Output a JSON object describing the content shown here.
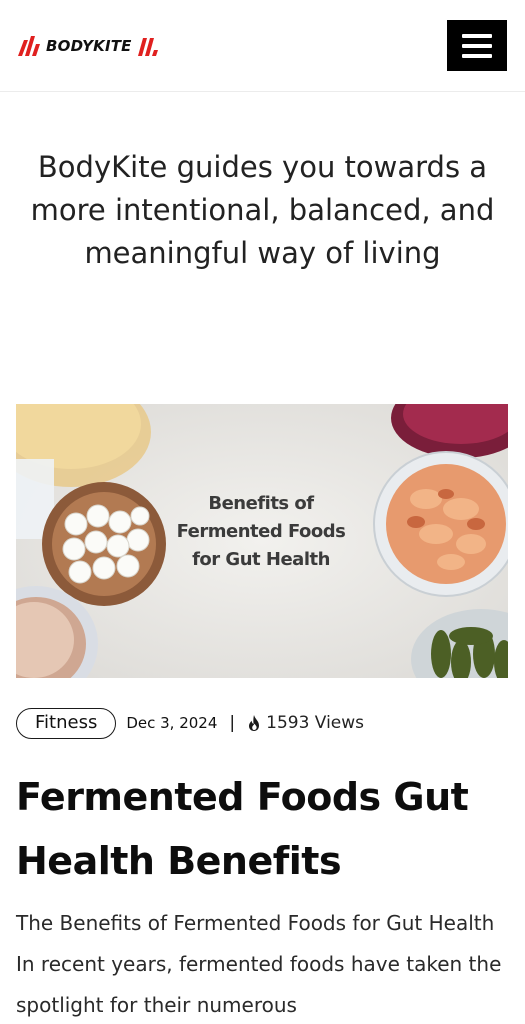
{
  "header": {
    "brand": "BODYKITE",
    "menu_icon": "hamburger-menu-icon",
    "accent_color": "#e0201f"
  },
  "hero_tagline": "BodyKite guides you towards a more intentional, balanced, and meaningful way of living",
  "post": {
    "image_caption_line1": "Benefits of",
    "image_caption_line2": "Fermented Foods",
    "image_caption_line3": "for Gut Health",
    "category": "Fitness",
    "date": "Dec 3, 2024",
    "separator": "|",
    "views_icon": "flame-icon",
    "views": "1593 Views",
    "title": "Fermented Foods Gut Health Benefits",
    "excerpt": "The Benefits of Fermented Foods for Gut Health In recent years, fermented foods have taken the spotlight for their numerous"
  }
}
